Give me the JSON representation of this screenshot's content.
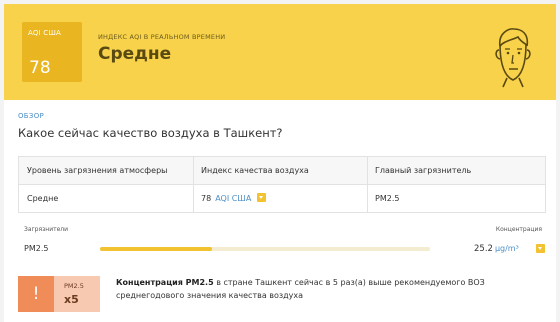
{
  "header": {
    "aqi_label": "AQI США",
    "aqi_value": "78",
    "realtime_label": "ИНДЕКС AQI В РЕАЛЬНОМ ВРЕМЕНИ",
    "status": "Средне",
    "face_icon": "neutral-face-icon",
    "color": "#f7d24a",
    "box_color": "#e9b521"
  },
  "overview": {
    "label": "ОБЗОР",
    "question": "Какое сейчас качество воздуха в Ташкент?",
    "table": {
      "headers": [
        "Уровень загрязнения атмосферы",
        "Индекс качества воздуха",
        "Главный загрязнитель"
      ],
      "row": {
        "level": "Средне",
        "aqi_value": "78",
        "aqi_unit": "AQI США",
        "pollutant": "PM2.5"
      }
    }
  },
  "pollutants": {
    "label_left": "Загрязнители",
    "label_right": "Концентрация",
    "items": [
      {
        "name": "PM2.5",
        "value": "25.2",
        "unit": "µg/m³",
        "level_fraction": 0.34
      }
    ]
  },
  "alert": {
    "icon": "!",
    "pollutant": "PM2.5",
    "multiplier": "x5",
    "text_bold": "Концентрация PM2.5",
    "text_rest": " в стране Ташкент сейчас в 5 раз(а) выше рекомендуемого ВОЗ среднегодового значения качества воздуха"
  }
}
